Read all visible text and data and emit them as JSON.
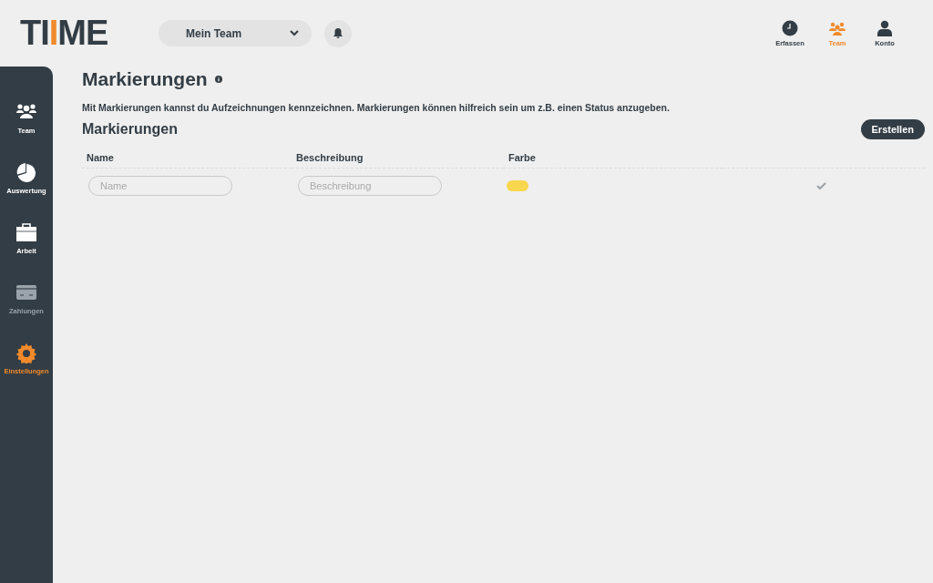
{
  "logo": [
    {
      "text": "TI",
      "accent": false
    },
    {
      "text": "I",
      "accent": true
    },
    {
      "text": "ME",
      "accent": false
    }
  ],
  "team_select": {
    "value": "Mein Team"
  },
  "top_nav": [
    {
      "label": "Erfassen",
      "selected": false
    },
    {
      "label": "Team",
      "selected": true
    },
    {
      "label": "Konto",
      "selected": false
    }
  ],
  "sidebar": {
    "items": [
      {
        "label": "Team",
        "selected": false,
        "disabled": false
      },
      {
        "label": "Auswertung",
        "selected": false,
        "disabled": false
      },
      {
        "label": "Arbeit",
        "selected": false,
        "disabled": false
      },
      {
        "label": "Zahlungen",
        "selected": false,
        "disabled": true
      },
      {
        "label": "Einstellungen",
        "selected": true,
        "disabled": false
      }
    ]
  },
  "page": {
    "title": "Markierungen",
    "description": "Mit Markierungen kannst du Aufzeichnungen kennzeichnen. Markierungen können hilfreich sein um z.B. einen Status anzugeben.",
    "section_title": "Markierungen",
    "create_button": "Erstellen"
  },
  "table": {
    "columns": [
      "Name",
      "Beschreibung",
      "Farbe"
    ],
    "new_row": {
      "name_placeholder": "Name",
      "description_placeholder": "Beschreibung",
      "color": "#f8d64e"
    }
  }
}
